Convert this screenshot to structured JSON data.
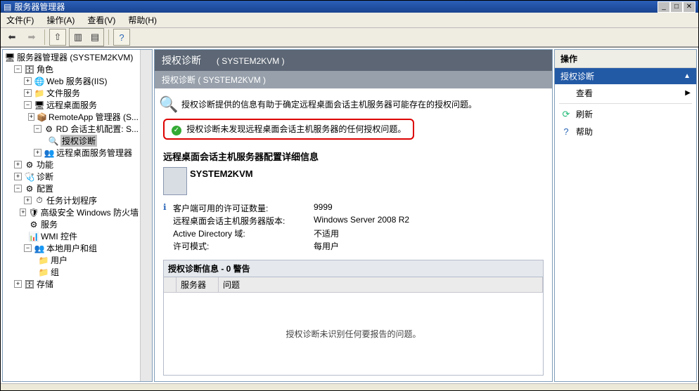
{
  "window": {
    "title": "服务器管理器"
  },
  "menubar": {
    "file": "文件(F)",
    "action": "操作(A)",
    "view": "查看(V)",
    "help": "帮助(H)"
  },
  "tree": {
    "root": "服务器管理器 (SYSTEM2KVM)",
    "roles": "角色",
    "web": "Web 服务器(IIS)",
    "fileservices": "文件服务",
    "rds": "远程桌面服务",
    "remoteapp": "RemoteApp 管理器 (S...",
    "rdconfig": "RD 会话主机配置: S...",
    "licensing": "授权诊断",
    "rdsmgr": "远程桌面服务管理器",
    "features": "功能",
    "diag": "诊断",
    "config": "配置",
    "tasksched": "任务计划程序",
    "firewall": "高级安全 Windows 防火墙",
    "services": "服务",
    "wmi": "WMI 控件",
    "localusers": "本地用户和组",
    "users": "用户",
    "groups": "组",
    "storage": "存储"
  },
  "main": {
    "title": "授权诊断",
    "title_suffix": "( SYSTEM2KVM )",
    "subtitle": "授权诊断 ( SYSTEM2KVM )",
    "intro": "授权诊断提供的信息有助于确定远程桌面会话主机服务器可能存在的授权问题。",
    "status_ok": "授权诊断未发现远程桌面会话主机服务器的任何授权问题。",
    "details_title": "远程桌面会话主机服务器配置详细信息",
    "server_name": "SYSTEM2KVM",
    "kv": {
      "licenses_key": "客户端可用的许可证数量:",
      "licenses_val": "9999",
      "version_key": "远程桌面会话主机服务器版本:",
      "version_val": "Windows Server 2008 R2",
      "ad_key": "Active Directory 域:",
      "ad_val": "不适用",
      "mode_key": "许可模式:",
      "mode_val": "每用户"
    },
    "warn_header": "授权诊断信息 - 0 警告",
    "col_server": "服务器",
    "col_problem": "问题",
    "no_issues": "授权诊断未识别任何要报告的问题。"
  },
  "actions": {
    "pane_title": "操作",
    "group_title": "授权诊断",
    "view": "查看",
    "refresh": "刷新",
    "help": "帮助"
  }
}
